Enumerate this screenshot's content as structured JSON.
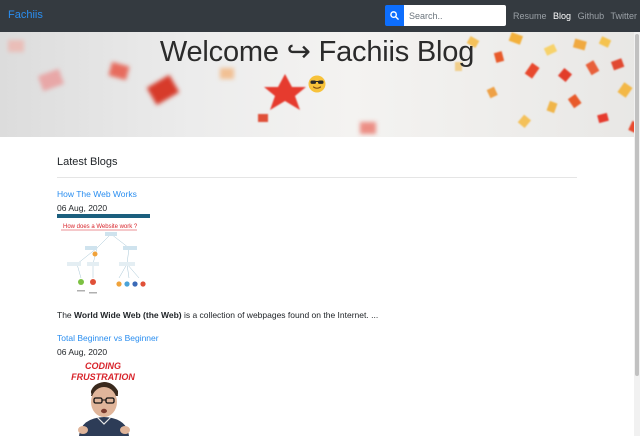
{
  "navbar": {
    "brand": "Fachiis",
    "search_placeholder": "Search..",
    "links": [
      {
        "label": "Resume",
        "active": false
      },
      {
        "label": "Blog",
        "active": true
      },
      {
        "label": "Github",
        "active": false
      },
      {
        "label": "Twitter",
        "active": false
      }
    ]
  },
  "hero": {
    "title": "Welcome ↪ Fachiis Blog",
    "emoji": "sunglasses-emoji"
  },
  "main": {
    "section_title": "Latest Blogs",
    "posts": [
      {
        "title": "How The Web Works",
        "date": "06 Aug, 2020",
        "thumbnail": {
          "heading": "How does a Website work ?"
        },
        "excerpt_prefix": "The ",
        "excerpt_bold": "World Wide Web (the Web)",
        "excerpt_suffix": " is a collection of webpages found on the Internet. ..."
      },
      {
        "title": "Total Beginner vs Beginner",
        "date": "06 Aug, 2020",
        "thumbnail": {
          "line1": "CODING",
          "line2": "FRUSTRATION"
        }
      }
    ]
  },
  "colors": {
    "navbar_bg": "#343a40",
    "link": "#2a8ef0",
    "search_button": "#0d6efd"
  }
}
